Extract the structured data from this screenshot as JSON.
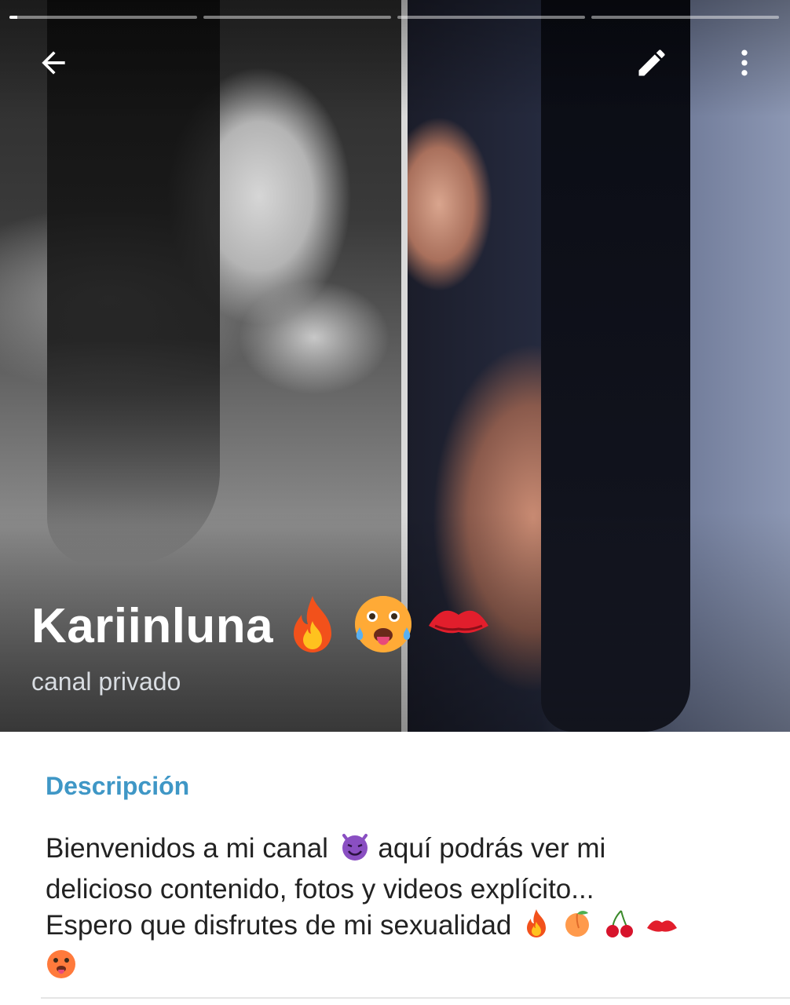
{
  "header": {
    "story_progress": [
      0.04,
      0,
      0,
      0
    ],
    "back_icon": "arrow-back-icon",
    "edit_icon": "pencil-icon",
    "more_icon": "more-vertical-icon"
  },
  "channel": {
    "name": "Kariinluna",
    "name_emojis": [
      "fire-emoji",
      "hot-face-emoji",
      "kiss-mark-emoji"
    ],
    "subtitle": "canal privado"
  },
  "description": {
    "label": "Descripción",
    "line1_a": "Bienvenidos a mi canal",
    "line1_b": "aquí podrás ver mi",
    "line2": "delicioso contenido, fotos y videos explícito...",
    "line3": "Espero que disfrutes de mi sexualidad"
  },
  "colors": {
    "accent": "#3f97c6",
    "text": "#222222",
    "header_text": "#ffffff"
  }
}
